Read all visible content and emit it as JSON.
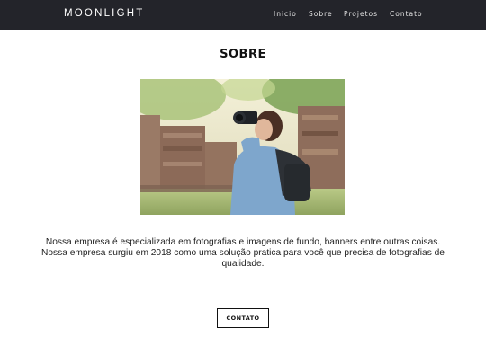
{
  "header": {
    "brand": "MOONLIGHT",
    "nav": [
      "Inicio",
      "Sobre",
      "Projetos",
      "Contato"
    ]
  },
  "main": {
    "title": "SOBRE",
    "paragraph_lines": [
      "Nossa empresa é especializada em fotografias e imagens de fundo, banners entre outras coisas.",
      "Nossa empresa surgiu em 2018 como uma solução pratica para você que precisa de fotografias de qualidade."
    ],
    "button_label": "CONTATO"
  },
  "colors": {
    "navbar": "#23242a",
    "text": "#222222"
  }
}
